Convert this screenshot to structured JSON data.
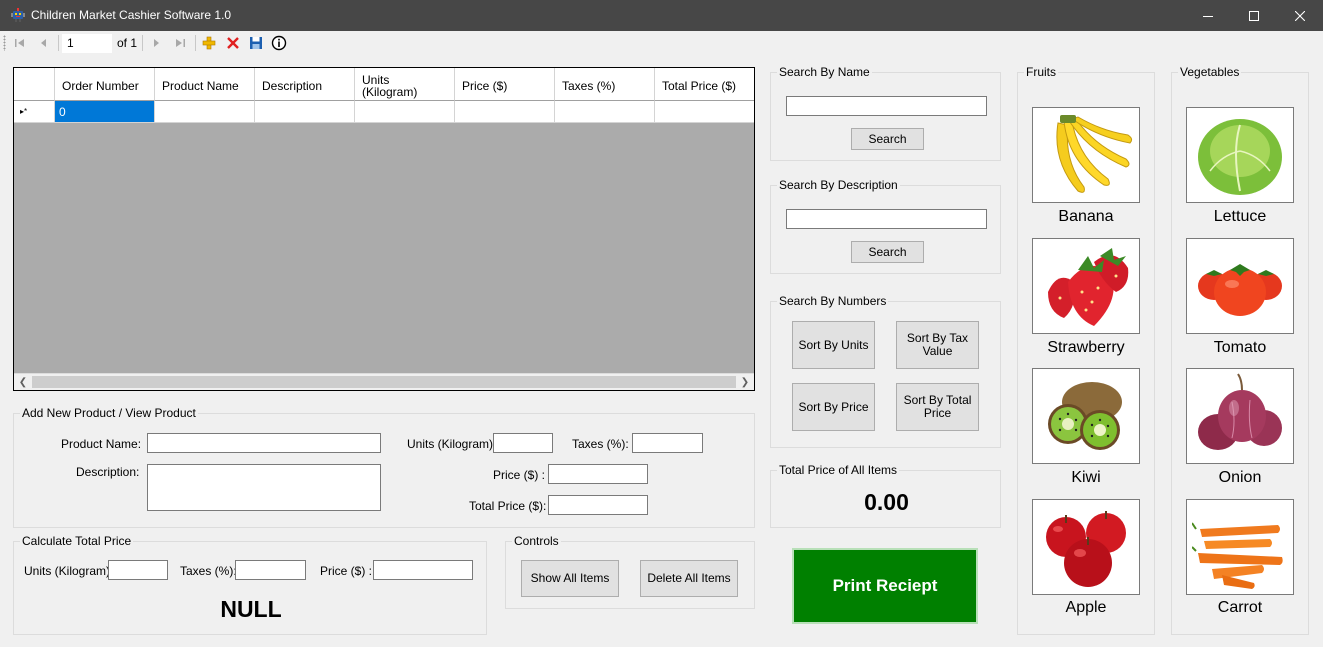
{
  "window": {
    "title": "Children Market Cashier Software 1.0",
    "app_icon": "robot-app-icon",
    "controls": [
      "minimize-icon",
      "maximize-icon",
      "close-icon"
    ]
  },
  "navigator": {
    "position": "1",
    "count_label": "of 1",
    "buttons": [
      "move-first-icon",
      "move-previous-icon",
      "move-next-icon",
      "move-last-icon",
      "add-new-icon",
      "delete-icon",
      "save-icon",
      "info-icon"
    ]
  },
  "grid": {
    "columns": [
      "Order Number",
      "Product Name",
      "Description",
      "Units\n(Kilogram)",
      "Price ($)",
      "Taxes (%)",
      "Total Price ($)"
    ],
    "new_row": {
      "order_number": "0"
    },
    "row_indicator": "▸*"
  },
  "add_product": {
    "title": "Add New Product / View Product",
    "product_name_label": "Product Name:",
    "description_label": "Description:",
    "units_label": "Units (Kilogram):",
    "taxes_label": "Taxes (%):",
    "price_label": "Price ($) :",
    "total_price_label": "Total Price ($):"
  },
  "calculate": {
    "title": "Calculate Total Price",
    "units_label": "Units (Kilogram):",
    "taxes_label": "Taxes (%):",
    "price_label": "Price ($) :",
    "result": "NULL"
  },
  "controls": {
    "title": "Controls",
    "show_all": "Show All Items",
    "delete_all": "Delete All Items"
  },
  "search_name": {
    "title": "Search By Name",
    "button": "Search"
  },
  "search_description": {
    "title": "Search By Description",
    "button": "Search"
  },
  "search_numbers": {
    "title": "Search By Numbers",
    "sort_units": "Sort By Units",
    "sort_tax": "Sort By Tax Value",
    "sort_price": "Sort By Price",
    "sort_total": "Sort By Total Price"
  },
  "total_all": {
    "title": "Total Price of All Items",
    "value": "0.00"
  },
  "print_button": "Print Reciept",
  "fruits": {
    "title": "Fruits",
    "items": [
      {
        "name": "Banana",
        "icon": "banana-image"
      },
      {
        "name": "Strawberry",
        "icon": "strawberry-image"
      },
      {
        "name": "Kiwi",
        "icon": "kiwi-image"
      },
      {
        "name": "Apple",
        "icon": "apple-image"
      }
    ]
  },
  "vegetables": {
    "title": "Vegetables",
    "items": [
      {
        "name": "Lettuce",
        "icon": "lettuce-image"
      },
      {
        "name": "Tomato",
        "icon": "tomato-image"
      },
      {
        "name": "Onion",
        "icon": "onion-image"
      },
      {
        "name": "Carrot",
        "icon": "carrot-image"
      }
    ]
  },
  "colors": {
    "titlebar": "#474747",
    "selection": "#0078d7",
    "print_button": "#008000",
    "grid_background": "#ababab"
  }
}
